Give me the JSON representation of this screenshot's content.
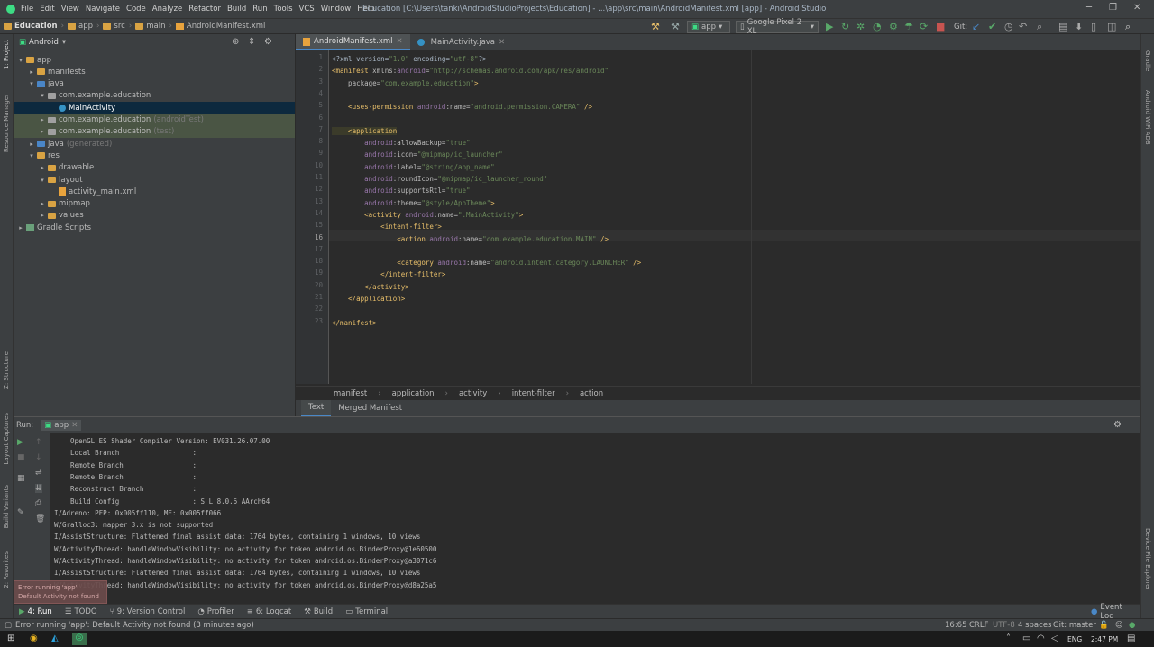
{
  "window": {
    "menu": [
      "File",
      "Edit",
      "View",
      "Navigate",
      "Code",
      "Analyze",
      "Refactor",
      "Build",
      "Run",
      "Tools",
      "VCS",
      "Window",
      "Help"
    ],
    "title": "Education [C:\\Users\\tanki\\AndroidStudioProjects\\Education] - ...\\app\\src\\main\\AndroidManifest.xml [app] - Android Studio",
    "controls": [
      "minimize-icon",
      "maximize-icon",
      "close-icon"
    ]
  },
  "navbar": {
    "breadcrumbs": [
      "Education",
      "app",
      "src",
      "main",
      "AndroidManifest.xml"
    ],
    "run_config": "app",
    "device": "Google Pixel 2 XL",
    "git_label": "Git:"
  },
  "left_strip": {
    "tabs": [
      "1: Project",
      "Resource Manager",
      "Z: Structure",
      "Layout Captures",
      "Build Variants",
      "2: Favorites"
    ]
  },
  "right_strip": {
    "tabs": [
      "Gradle",
      "Android WiFi ADB",
      "Device File Explorer"
    ]
  },
  "project": {
    "view": "Android",
    "tree": [
      {
        "label": "app",
        "suffix": "",
        "depth": 0,
        "arrow": "▾",
        "kind": "folder"
      },
      {
        "label": "manifests",
        "suffix": "",
        "depth": 1,
        "arrow": "▸",
        "kind": "folder"
      },
      {
        "label": "java",
        "suffix": "",
        "depth": 1,
        "arrow": "▾",
        "kind": "folder"
      },
      {
        "label": "com.example.education",
        "suffix": "",
        "depth": 2,
        "arrow": "▾",
        "kind": "package"
      },
      {
        "label": "MainActivity",
        "suffix": "",
        "depth": 3,
        "arrow": "",
        "kind": "class"
      },
      {
        "label": "com.example.education",
        "suffix": "(androidTest)",
        "depth": 2,
        "arrow": "▸",
        "kind": "package"
      },
      {
        "label": "com.example.education",
        "suffix": "(test)",
        "depth": 2,
        "arrow": "▸",
        "kind": "package"
      },
      {
        "label": "java",
        "suffix": "(generated)",
        "depth": 1,
        "arrow": "▸",
        "kind": "folder"
      },
      {
        "label": "res",
        "suffix": "",
        "depth": 1,
        "arrow": "▾",
        "kind": "folder"
      },
      {
        "label": "drawable",
        "suffix": "",
        "depth": 2,
        "arrow": "▸",
        "kind": "folder"
      },
      {
        "label": "layout",
        "suffix": "",
        "depth": 2,
        "arrow": "▾",
        "kind": "folder"
      },
      {
        "label": "activity_main.xml",
        "suffix": "",
        "depth": 3,
        "arrow": "",
        "kind": "xml"
      },
      {
        "label": "mipmap",
        "suffix": "",
        "depth": 2,
        "arrow": "▸",
        "kind": "folder"
      },
      {
        "label": "values",
        "suffix": "",
        "depth": 2,
        "arrow": "▸",
        "kind": "folder"
      },
      {
        "label": "Gradle Scripts",
        "suffix": "",
        "depth": 0,
        "arrow": "▸",
        "kind": "gradle"
      }
    ]
  },
  "editor": {
    "tabs": [
      {
        "label": "AndroidManifest.xml",
        "active": true
      },
      {
        "label": "MainActivity.java",
        "active": false
      }
    ],
    "current_line": 16,
    "lines": [
      [
        [
          "p",
          "<?xml version="
        ],
        [
          "s",
          "\"1.0\""
        ],
        [
          "p",
          " encoding="
        ],
        [
          "s",
          "\"utf-8\""
        ],
        [
          "p",
          "?>"
        ]
      ],
      [
        [
          "t",
          "<manifest "
        ],
        [
          "a",
          "xmlns:"
        ],
        [
          "ns",
          "android"
        ],
        [
          "a",
          "="
        ],
        [
          "s",
          "\"http://schemas.android.com/apk/res/android\""
        ]
      ],
      [
        [
          "a",
          "    package="
        ],
        [
          "s",
          "\"com.example.education\""
        ],
        [
          "t",
          ">"
        ]
      ],
      [],
      [
        [
          "t",
          "    <uses-permission "
        ],
        [
          "ns",
          "android"
        ],
        [
          "a",
          ":name="
        ],
        [
          "s",
          "\"android.permission.CAMERA\""
        ],
        [
          "t",
          " />"
        ]
      ],
      [],
      [
        [
          "t",
          "    <application"
        ]
      ],
      [
        [
          "ns",
          "        android"
        ],
        [
          "a",
          ":allowBackup="
        ],
        [
          "s",
          "\"true\""
        ]
      ],
      [
        [
          "ns",
          "        android"
        ],
        [
          "a",
          ":icon="
        ],
        [
          "s",
          "\"@mipmap/ic_launcher\""
        ]
      ],
      [
        [
          "ns",
          "        android"
        ],
        [
          "a",
          ":label="
        ],
        [
          "s",
          "\"@string/app_name\""
        ]
      ],
      [
        [
          "ns",
          "        android"
        ],
        [
          "a",
          ":roundIcon="
        ],
        [
          "s",
          "\"@mipmap/ic_launcher_round\""
        ]
      ],
      [
        [
          "ns",
          "        android"
        ],
        [
          "a",
          ":supportsRtl="
        ],
        [
          "s",
          "\"true\""
        ]
      ],
      [
        [
          "ns",
          "        android"
        ],
        [
          "a",
          ":theme="
        ],
        [
          "s",
          "\"@style/AppTheme\""
        ],
        [
          "t",
          ">"
        ]
      ],
      [
        [
          "t",
          "        <activity "
        ],
        [
          "ns",
          "android"
        ],
        [
          "a",
          ":name="
        ],
        [
          "s",
          "\".MainActivity\""
        ],
        [
          "t",
          ">"
        ]
      ],
      [
        [
          "t",
          "            <intent-filter>"
        ]
      ],
      [
        [
          "t",
          "                <action "
        ],
        [
          "ns",
          "android"
        ],
        [
          "a",
          ":name="
        ],
        [
          "s",
          "\"com.example.education.MAIN\""
        ],
        [
          "t",
          " />"
        ]
      ],
      [],
      [
        [
          "t",
          "                <category "
        ],
        [
          "ns",
          "android"
        ],
        [
          "a",
          ":name="
        ],
        [
          "s",
          "\"android.intent.category.LAUNCHER\""
        ],
        [
          "t",
          " />"
        ]
      ],
      [
        [
          "t",
          "            </intent-filter>"
        ]
      ],
      [
        [
          "t",
          "        </activity>"
        ]
      ],
      [
        [
          "t",
          "    </application>"
        ]
      ],
      [],
      [
        [
          "t",
          "</manifest>"
        ]
      ]
    ],
    "breadcrumb": [
      "manifest",
      "application",
      "activity",
      "intent-filter",
      "action"
    ],
    "bottom_tabs": [
      "Text",
      "Merged Manifest"
    ]
  },
  "run": {
    "label": "Run:",
    "config": "app",
    "console": [
      "    OpenGL ES Shader Compiler Version: EV031.26.07.00",
      "    Local Branch                  :",
      "    Remote Branch                 :",
      "    Remote Branch                 :",
      "    Reconstruct Branch            :",
      "    Build Config                  : S L 8.0.6 AArch64",
      "I/Adreno: PFP: 0x005ff110, ME: 0x005ff066",
      "W/Gralloc3: mapper 3.x is not supported",
      "I/AssistStructure: Flattened final assist data: 1764 bytes, containing 1 windows, 10 views",
      "W/ActivityThread: handleWindowVisibility: no activity for token android.os.BinderProxy@1e60500",
      "W/ActivityThread: handleWindowVisibility: no activity for token android.os.BinderProxy@a3071c6",
      "I/AssistStructure: Flattened final assist data: 1764 bytes, containing 1 windows, 10 views",
      "W/ActivityThread: handleWindowVisibility: no activity for token android.os.BinderProxy@d8a25a5"
    ],
    "error_tooltip": [
      "Error running 'app'",
      "Default Activity not found"
    ]
  },
  "tool_tabs": [
    {
      "label": "4: Run",
      "icon": "play-icon"
    },
    {
      "label": "TODO",
      "icon": "list-icon"
    },
    {
      "label": "9: Version Control",
      "icon": "branch-icon"
    },
    {
      "label": "Profiler",
      "icon": "gauge-icon"
    },
    {
      "label": "6: Logcat",
      "icon": "logcat-icon"
    },
    {
      "label": "Build",
      "icon": "hammer-icon"
    },
    {
      "label": "Terminal",
      "icon": "terminal-icon"
    }
  ],
  "event_log": "Event Log",
  "status": {
    "message": "Error running 'app': Default Activity not found (3 minutes ago)",
    "position": "16:65",
    "line_sep": "CRLF",
    "encoding": "UTF-8",
    "indent": "4 spaces",
    "git": "Git: master"
  },
  "taskbar": {
    "lang": "ENG",
    "time": "2:47 PM"
  },
  "colors": {
    "accent": "#4a88c7",
    "selection": "#0d293e",
    "tag": "#e8bf6a",
    "string": "#6a8759",
    "namespace": "#9876aa"
  }
}
